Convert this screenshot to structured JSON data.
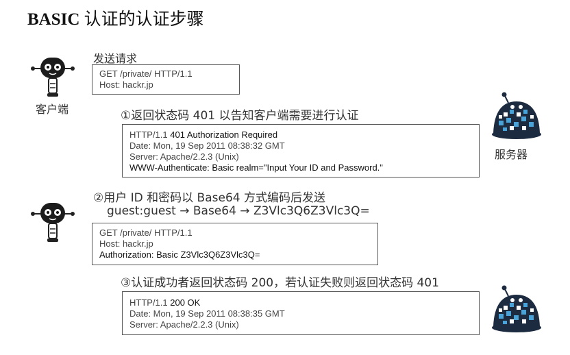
{
  "title": {
    "prefix": "BASIC",
    "rest": " 认证的认证步骤"
  },
  "labels": {
    "client": "客户端",
    "server": "服务器",
    "send_request": "发送请求"
  },
  "steps": {
    "step1": "①返回状态码 401 以告知客户端需要进行认证",
    "step2": "②用户 ID 和密码以 Base64 方式编码后发送",
    "step2_encoding": "guest:guest → Base64 → Z3Vlc3Q6Z3Vlc3Q=",
    "step3": "③认证成功者返回状态码 200，若认证失败则返回状态码 401"
  },
  "boxes": {
    "request1": [
      "GET /private/ HTTP/1.1",
      "Host: hackr.jp"
    ],
    "response401": {
      "status_prefix": "HTTP/1.1 ",
      "status_bold": "401 Authorization Required",
      "lines": [
        "Date: Mon, 19 Sep 2011 08:38:32 GMT",
        "Server: Apache/2.2.3 (Unix)"
      ],
      "auth_line": "WWW-Authenticate: Basic realm=\"Input Your ID and Password.\""
    },
    "request2": {
      "lines": [
        "GET /private/ HTTP/1.1",
        "Host: hackr.jp"
      ],
      "auth_line": "Authorization: Basic Z3Vlc3Q6Z3Vlc3Q="
    },
    "response200": {
      "status_prefix": "HTTP/1.1 ",
      "status_bold": "200 OK",
      "lines": [
        "Date: Mon, 19 Sep 2011 08:38:35 GMT",
        "Server: Apache/2.2.3 (Unix)"
      ]
    }
  },
  "icons": {
    "client": "robot-icon",
    "server": "server-turtle-icon"
  },
  "colors": {
    "server_body": "#1d2b40",
    "server_pattern": "#4aa3d8",
    "robot_body": "#1c1c1c"
  }
}
